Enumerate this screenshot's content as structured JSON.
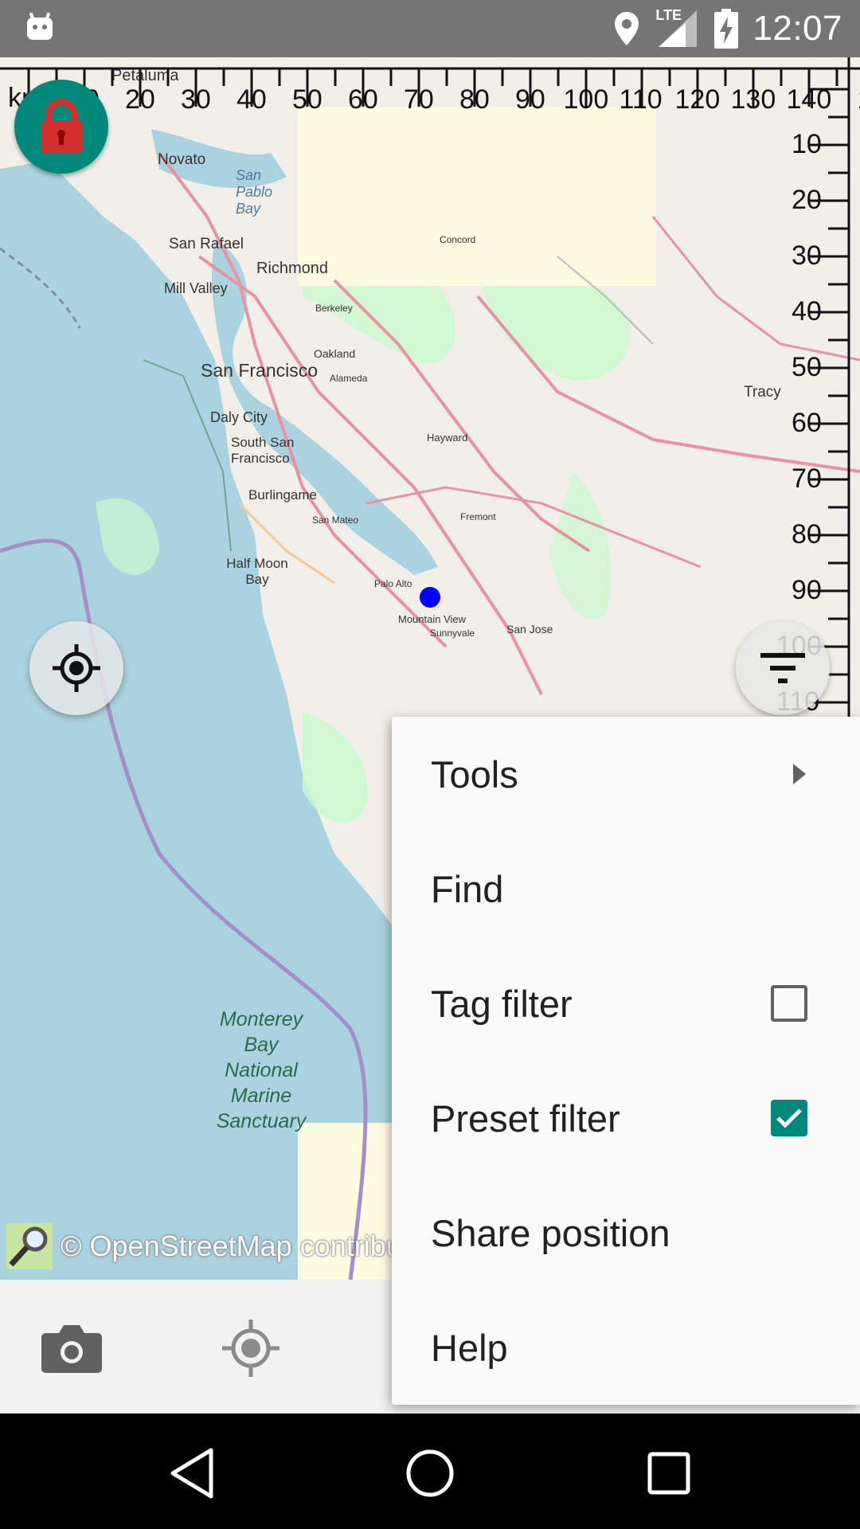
{
  "status_bar": {
    "time": "12:07",
    "network": "LTE",
    "icons": [
      "android-icon",
      "location-icon",
      "signal-icon",
      "battery-charging-icon"
    ]
  },
  "map": {
    "attribution": "© OpenStreetMap contribu",
    "place_labels": [
      "Petaluma",
      "Novato",
      "San Pablo Bay",
      "San Rafael",
      "Mill Valley",
      "Richmond",
      "Concord",
      "Berkeley",
      "Oakland",
      "San Francisco",
      "Alameda",
      "Daly City",
      "South San Francisco",
      "Hayward",
      "Tracy",
      "Burlingame",
      "San Mateo",
      "Half Moon Bay",
      "Fremont",
      "Palo Alto",
      "Mountain View",
      "Sunnyvale",
      "San Jose",
      "Monterey Bay National Marine Sanctuary"
    ],
    "colors": {
      "water": "#aad3df",
      "land": "#f2efe9",
      "park": "#c8facc",
      "road": "#e892a2"
    }
  },
  "ruler": {
    "unit_label": "km",
    "top_ticks": [
      "10",
      "20",
      "30",
      "40",
      "50",
      "60",
      "70",
      "80",
      "90",
      "100",
      "110",
      "120",
      "130",
      "140",
      "1"
    ],
    "right_ticks": [
      "10",
      "20",
      "30",
      "40",
      "50",
      "60",
      "70",
      "80",
      "90",
      "100",
      "110"
    ]
  },
  "buttons": {
    "lock": "lock-icon",
    "gps": "gps-fixed-icon",
    "filter": "filter-icon",
    "camera": "camera-icon",
    "toolbar_gps": "gps-icon"
  },
  "menu": {
    "items": [
      {
        "label": "Tools",
        "type": "submenu"
      },
      {
        "label": "Find",
        "type": "item"
      },
      {
        "label": "Tag filter",
        "type": "checkbox",
        "checked": false
      },
      {
        "label": "Preset filter",
        "type": "checkbox",
        "checked": true
      },
      {
        "label": "Share position",
        "type": "item"
      },
      {
        "label": "Help",
        "type": "item"
      }
    ],
    "accent": "#00897b"
  },
  "nav_bar": {
    "buttons": [
      "back-icon",
      "home-icon",
      "recents-icon"
    ]
  }
}
